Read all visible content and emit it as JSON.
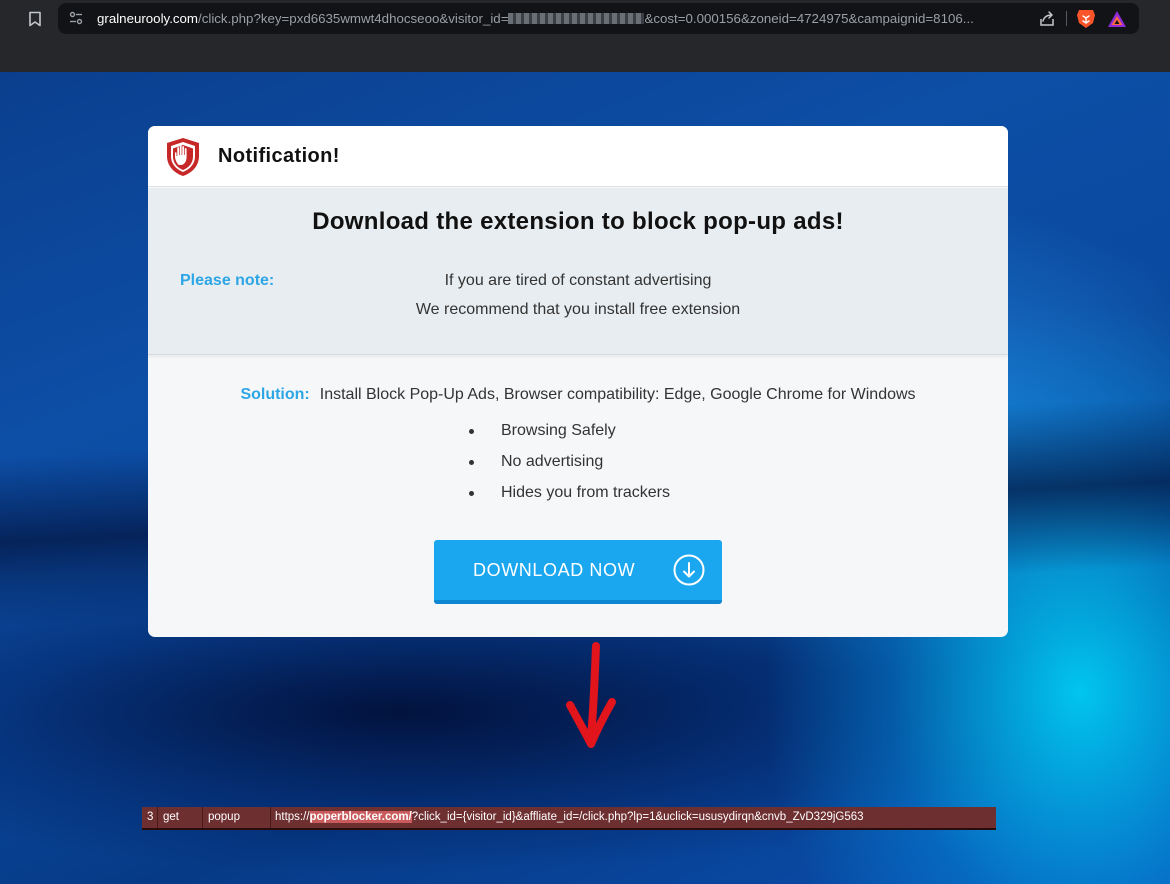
{
  "browser": {
    "url_host": "gralneurooly.com",
    "url_path_before_redaction": "/click.php?key=pxd6635wmwt4dhocseoo&visitor_id=",
    "url_path_after_redaction": "&cost=0.000156&zoneid=4724975&campaignid=8106..."
  },
  "modal": {
    "title": "Notification!",
    "headline": "Download the extension to block pop-up ads!",
    "note_label": "Please note:",
    "note_line1": "If you are tired of constant advertising",
    "note_line2": "We recommend that you install free extension",
    "solution_label": "Solution:",
    "solution_text": "Install Block Pop-Up Ads, Browser compatibility: Edge, Google Chrome for Windows",
    "features": [
      "Browsing Safely",
      "No advertising",
      "Hides you from trackers"
    ],
    "download_label": "DOWNLOAD NOW"
  },
  "log": {
    "index": "3",
    "method": "get",
    "type": "popup",
    "url_prefix": "https://",
    "url_domain": "poperblocker.com/",
    "url_rest": "?click_id={visitor_id}&affliate_id=/click.php?lp=1&uclick=ususydirqn&cnvb_ZvD329jG563"
  },
  "colors": {
    "accent_blue": "#1ba6f0",
    "label_blue": "#2ea6e6",
    "shield_red": "#c62828",
    "arrow_red": "#e2141c",
    "log_background": "#6e2f31"
  },
  "icons": {
    "bookmark": "bookmark-icon",
    "site_settings": "site-settings-icon",
    "share": "share-icon",
    "brave": "brave-lion-icon",
    "rewards": "brave-rewards-icon",
    "shield": "shield-hand-icon",
    "download": "download-circle-icon",
    "arrow": "red-down-arrow"
  }
}
